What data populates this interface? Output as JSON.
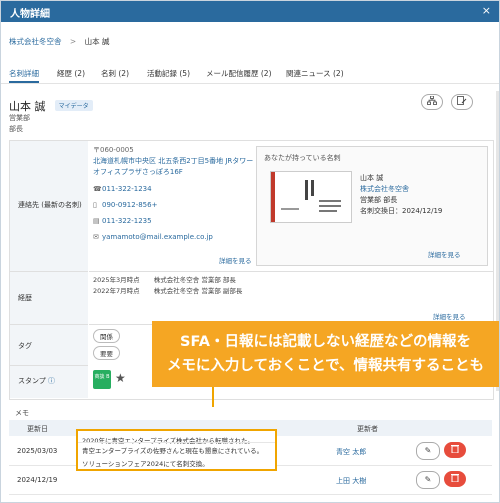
{
  "title": "人物詳細",
  "close": "×",
  "breadcrumb": {
    "company": "株式会社冬空舎",
    "sep": ">",
    "person": "山本 誠"
  },
  "tabs": [
    {
      "label": "名刺詳細"
    },
    {
      "label": "経歴 (2)"
    },
    {
      "label": "名刺 (2)"
    },
    {
      "label": "活動記録 (5)"
    },
    {
      "label": "メール配信履歴 (2)"
    },
    {
      "label": "関連ニュース (2)"
    }
  ],
  "person": {
    "name": "山本 誠",
    "badge": "マイデータ",
    "dept": "営業部",
    "role": "部長"
  },
  "contact": {
    "label": "連絡先 (最新の名刺)",
    "zip": "〒060-0005",
    "address1": "北海道札幌市中央区 北五条西2丁目5番地 JRタワー",
    "address2": "オフィスプラザさっぽろ16F",
    "tel": "011-322-1234",
    "mobile": "090-0912-856+",
    "fax": "011-322-1235",
    "email": "yamamoto@mail.example.co.jp",
    "more": "詳細を見る"
  },
  "card": {
    "header": "あなたが持っている名刺",
    "name": "山本 誠",
    "company": "株式会社冬空舎",
    "dept": "営業部 部長",
    "exchanged": "名刺交換日：2024/12/19",
    "more": "詳細を見る"
  },
  "career": {
    "label": "経歴",
    "rows": [
      {
        "date": "2025年3月時点",
        "text": "株式会社冬空舎 営業部 部長"
      },
      {
        "date": "2022年7月時点",
        "text": "株式会社冬空舎 営業部 副部長"
      }
    ],
    "more": "詳細を見る"
  },
  "tags": {
    "label": "タグ",
    "chip1": "関係",
    "chip2": "要要"
  },
  "stamp": {
    "label": "スタンプ",
    "info": "ⓘ",
    "stamp_text": "商談 B"
  },
  "memo": {
    "label": "メモ",
    "col_date": "更新日",
    "col_author": "更新者",
    "rows": [
      {
        "date": "2025/03/03",
        "line1": "2020年に青空エンタープライズ株式会社から転職された。",
        "line2": "青空エンタープライズの佐野さんと現在も懇意にされている。",
        "author": "青空 太郎"
      },
      {
        "date": "2024/12/19",
        "line1": "ソリューションフェア2024にて名刺交換。",
        "line2": "",
        "author": "上田 大樹"
      }
    ]
  },
  "callout": {
    "line1": "SFA・日報には記載しない経歴などの情報を",
    "line2": "メモに入力しておくことで、情報共有することも"
  },
  "colors": {
    "primary": "#2a6a9e",
    "accent": "#f5a623",
    "danger": "#e74c3c"
  }
}
